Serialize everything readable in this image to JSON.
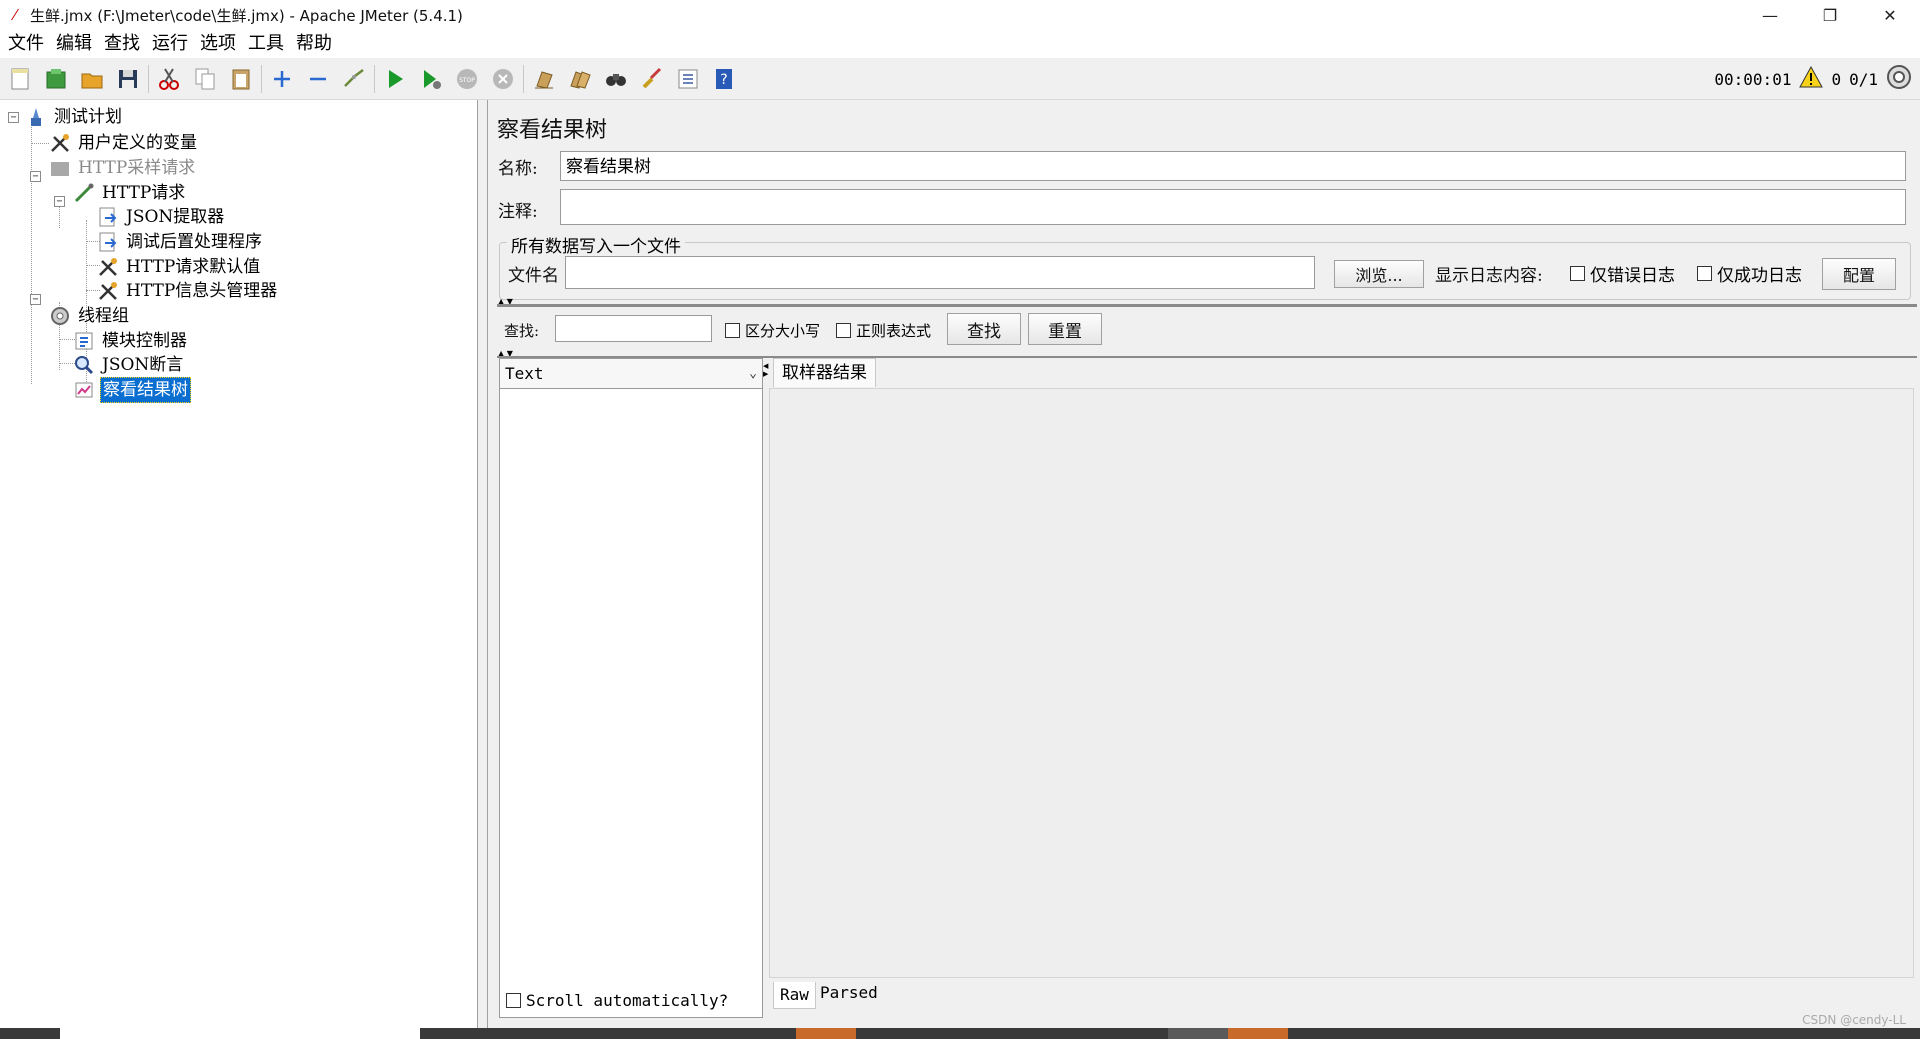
{
  "window": {
    "title": "生鲜.jmx (F:\\Jmeter\\code\\生鲜.jmx) - Apache JMeter (5.4.1)",
    "minimize": "—",
    "restore": "❐",
    "close": "✕"
  },
  "menu": [
    "文件",
    "编辑",
    "查找",
    "运行",
    "选项",
    "工具",
    "帮助"
  ],
  "toolbar": {
    "icons": [
      "new-icon",
      "templates-icon",
      "open-icon",
      "save-icon",
      "cut-icon",
      "copy-icon",
      "paste-icon",
      "expand-icon",
      "collapse-icon",
      "toggle-icon",
      "start-icon",
      "start-no-pause-icon",
      "stop-icon",
      "shutdown-icon",
      "clear-icon",
      "clear-all-icon",
      "search-icon",
      "reset-search-icon",
      "function-helper-icon",
      "help-icon"
    ],
    "timer": "00:00:01",
    "warning_count": "0",
    "threads": "0/1"
  },
  "tree": {
    "nodes": [
      {
        "label": "测试计划",
        "icon": "test-plan-icon"
      },
      {
        "label": "用户定义的变量",
        "icon": "config-tools-icon"
      },
      {
        "label": "HTTP采样请求",
        "icon": "sampler-disabled-icon",
        "disabled": true
      },
      {
        "label": "HTTP请求",
        "icon": "http-sampler-icon"
      },
      {
        "label": "JSON提取器",
        "icon": "post-processor-icon"
      },
      {
        "label": "调试后置处理程序",
        "icon": "post-processor-icon"
      },
      {
        "label": "HTTP请求默认值",
        "icon": "config-tools-icon"
      },
      {
        "label": "HTTP信息头管理器",
        "icon": "config-tools-icon"
      },
      {
        "label": "线程组",
        "icon": "thread-group-icon"
      },
      {
        "label": "模块控制器",
        "icon": "module-controller-icon"
      },
      {
        "label": "JSON断言",
        "icon": "assertion-icon"
      },
      {
        "label": "察看结果树",
        "icon": "listener-icon",
        "selected": true
      }
    ]
  },
  "panel": {
    "title": "察看结果树",
    "name_label": "名称:",
    "name_value": "察看结果树",
    "comment_label": "注释:",
    "comment_value": "",
    "file_group_title": "所有数据写入一个文件",
    "filename_label": "文件名",
    "filename_value": "",
    "browse_button": "浏览...",
    "log_label": "显示日志内容:",
    "errors_only": "仅错误日志",
    "success_only": "仅成功日志",
    "configure_button": "配置",
    "search_label": "查找:",
    "search_value": "",
    "case_sensitive": "区分大小写",
    "regex": "正则表达式",
    "find_button": "查找",
    "reset_button": "重置",
    "renderer_value": "Text",
    "scroll_auto": "Scroll automatically?",
    "results_tab": "取样器结果",
    "raw_tab": "Raw",
    "parsed_tab": "Parsed"
  },
  "watermark": "CSDN @cendy-LL"
}
